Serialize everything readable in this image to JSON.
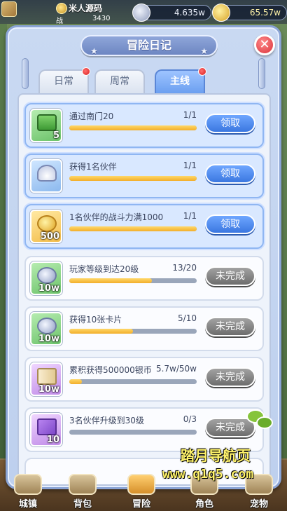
{
  "topbar": {
    "player_name": "米人源码",
    "sub_label": "战",
    "player_value": "3430",
    "silver": "4.635w",
    "gold": "65.57w"
  },
  "panel": {
    "title": "冒险日记",
    "close_symbol": "✕",
    "tabs": [
      {
        "label": "日常",
        "active": false,
        "has_dot": true
      },
      {
        "label": "周常",
        "active": false,
        "has_dot": false
      },
      {
        "label": "主线",
        "active": true,
        "has_dot": true
      }
    ]
  },
  "quests": [
    {
      "title": "通过南门20",
      "count": "1/1",
      "progress": 1.0,
      "reward_qty": "5",
      "reward_icon": "green-chest-icon",
      "button": "领取",
      "status": "claimable"
    },
    {
      "title": "获得1名伙伴",
      "count": "1/1",
      "progress": 1.0,
      "reward_qty": "",
      "reward_icon": "helmet-card-icon",
      "button": "领取",
      "status": "claimable"
    },
    {
      "title": "1名伙伴的战斗力满1000",
      "count": "1/1",
      "progress": 1.0,
      "reward_qty": "500",
      "reward_icon": "gold-coins-icon",
      "button": "领取",
      "status": "claimable"
    },
    {
      "title": "玩家等级到达20级",
      "count": "13/20",
      "progress": 0.65,
      "reward_qty": "10w",
      "reward_icon": "silver-coins-icon",
      "button": "未完成",
      "status": "incomplete"
    },
    {
      "title": "获得10张卡片",
      "count": "5/10",
      "progress": 0.5,
      "reward_qty": "10w",
      "reward_icon": "silver-coins-icon",
      "button": "未完成",
      "status": "incomplete"
    },
    {
      "title": "累积获得500000银币",
      "count": "5.7w/50w",
      "progress": 0.1,
      "reward_qty": "10w",
      "reward_icon": "scroll-icon",
      "button": "未完成",
      "status": "incomplete"
    },
    {
      "title": "3名伙伴升级到30级",
      "count": "0/3",
      "progress": 0.0,
      "reward_qty": "10",
      "reward_icon": "purple-book-icon",
      "button": "未完成",
      "status": "incomplete"
    }
  ],
  "bottom_nav": [
    {
      "label": "城镇"
    },
    {
      "label": "背包"
    },
    {
      "label": "冒险"
    },
    {
      "label": "角色"
    },
    {
      "label": "宠物"
    }
  ],
  "watermark": {
    "line1": "踏月导航页",
    "line2": "www.q1q5.com"
  },
  "colors": {
    "claim_button": "#3b77e0",
    "incomplete_button": "#6d6d6d",
    "progress_fill": "#f2ae2b",
    "tab_active": "#6b9ff0",
    "panel_bg": "#c9d9f2",
    "close_button": "#d9323b"
  }
}
